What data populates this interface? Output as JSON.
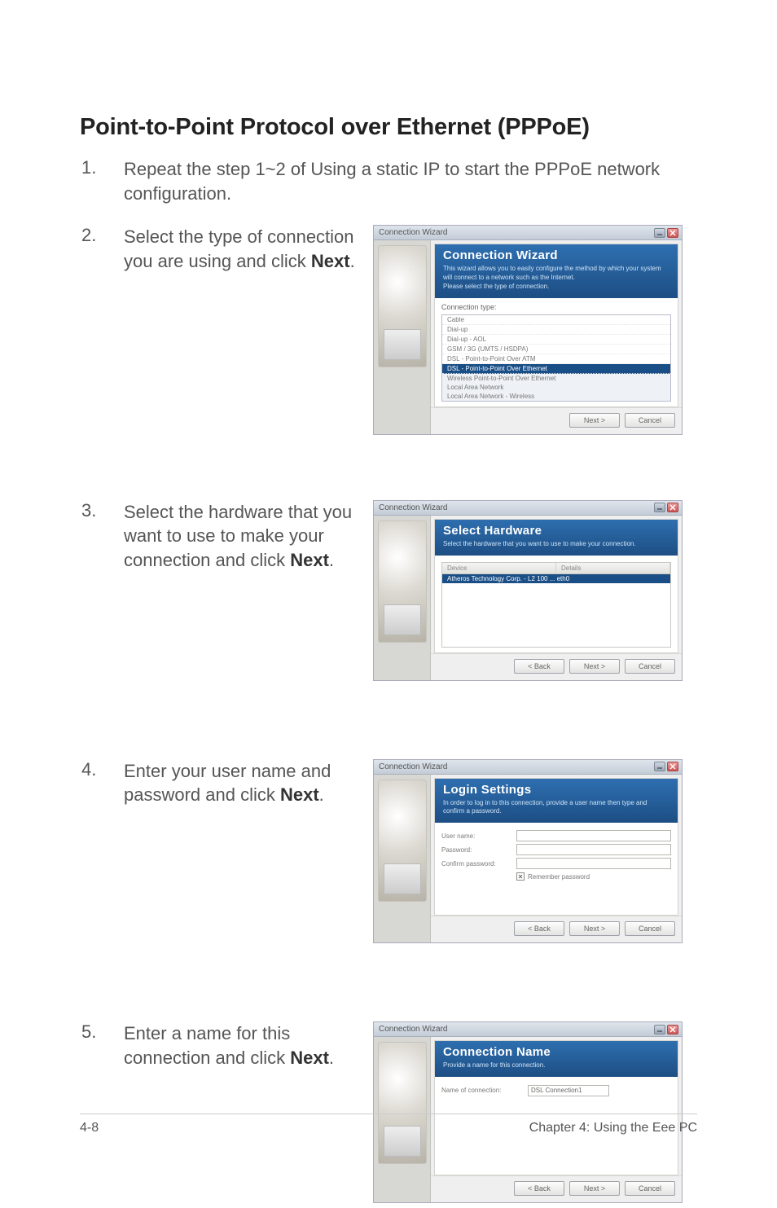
{
  "heading": "Point-to-Point Protocol over Ethernet (PPPoE)",
  "steps": {
    "s1": {
      "num": "1.",
      "text_a": "Repeat the step 1~2 of Using a static IP to start the PPPoE network configuration."
    },
    "s2": {
      "num": "2.",
      "text_a": "Select the type of connection you are using and click ",
      "bold": "Next",
      "text_b": "."
    },
    "s3": {
      "num": "3.",
      "text_a": "Select the hardware that you want to use to make your connection and click ",
      "bold": "Next",
      "text_b": "."
    },
    "s4": {
      "num": "4.",
      "text_a": "Enter your user name and password and click ",
      "bold": "Next",
      "text_b": "."
    },
    "s5": {
      "num": "5.",
      "text_a": "Enter a name for this connection and click ",
      "bold": "Next",
      "text_b": "."
    }
  },
  "dialogs": {
    "title": "Connection Wizard",
    "buttons": {
      "back": "< Back",
      "next": "Next >",
      "cancel": "Cancel"
    },
    "d2": {
      "banner_title": "Connection Wizard",
      "banner_desc": "This wizard allows you to easily configure the method by which your system will connect to a network such as the Internet.\nPlease select the type of connection.",
      "list_label": "Connection type:",
      "items": [
        "Cable",
        "Dial-up",
        "Dial-up - AOL",
        "GSM / 3G (UMTS / HSDPA)",
        "DSL - Point-to-Point Over ATM",
        "DSL - Point-to-Point Over Ethernet",
        "Wireless Point-to-Point Over Ethernet",
        "Local Area Network",
        "Local Area Network - Wireless"
      ]
    },
    "d3": {
      "banner_title": "Select Hardware",
      "banner_desc": "Select the hardware that you want to use to make your connection.",
      "col1": "Device",
      "col2": "Details",
      "row_device": "Atheros Technology Corp. - L2 100 ... eth0"
    },
    "d4": {
      "banner_title": "Login Settings",
      "banner_desc": "In order to log in to this connection, provide a user name then type and confirm a password.",
      "user": "User name:",
      "pwd": "Password:",
      "confirm": "Confirm password:",
      "remember": "Remember password"
    },
    "d5": {
      "banner_title": "Connection Name",
      "banner_desc": "Provide a name for this connection.",
      "name_label": "Name of connection:",
      "name_value": "DSL Connection1"
    }
  },
  "footer": {
    "left": "4-8",
    "right": "Chapter 4: Using the Eee PC"
  }
}
